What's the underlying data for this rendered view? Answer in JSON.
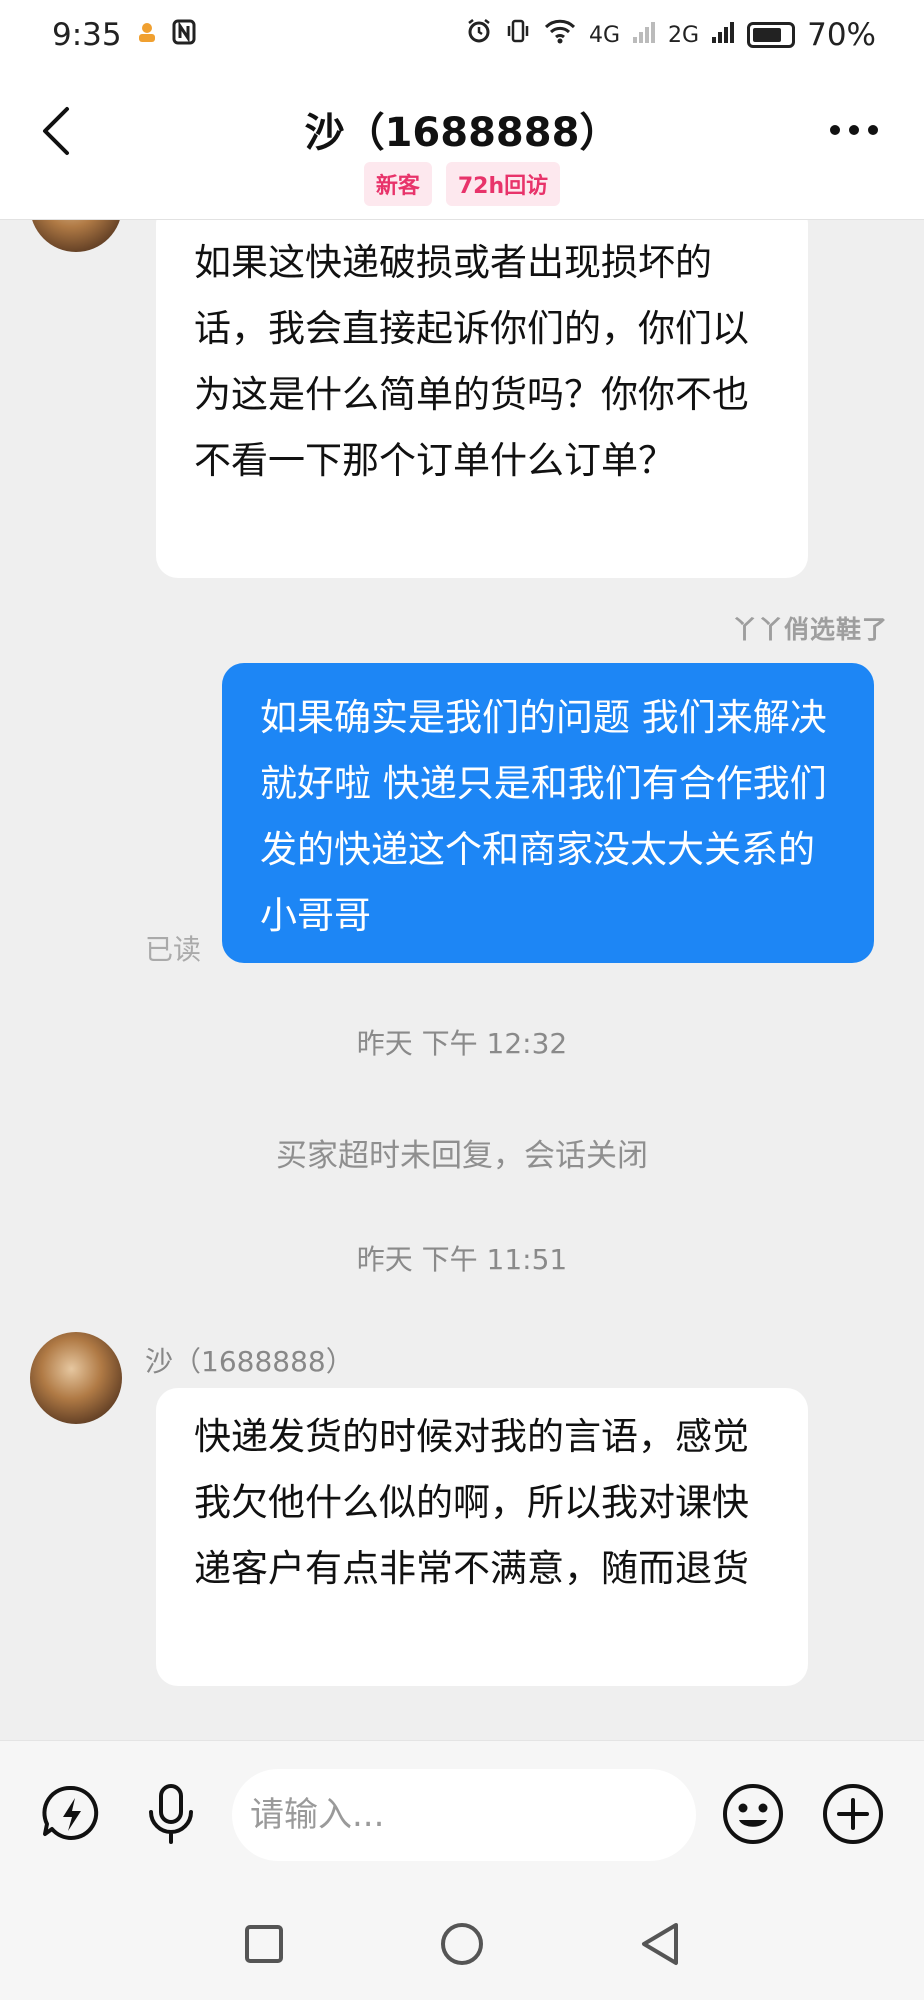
{
  "status_bar": {
    "time": "9:35",
    "signal_4g": "4G",
    "signal_2g": "2G",
    "battery": "70%"
  },
  "header": {
    "title": "沙（1688888）",
    "tags": [
      "新客",
      "72h回访"
    ]
  },
  "messages": {
    "first_incoming": "如果这快递破损或者出现损坏的话，我会直接起诉你们的，你们以为这是什么简单的货吗？你你不也不看一下那个订单什么订单？",
    "watermark": "丫丫俏选鞋了",
    "outgoing": "如果确实是我们的问题 我们来解决就好啦 快递只是和我们有合作我们发的快递这个和商家没太大关系的小哥哥",
    "read_receipt": "已读",
    "timestamp_1": "昨天 下午 12:32",
    "system_notice": "买家超时未回复，会话关闭",
    "timestamp_2": "昨天 下午 11:51",
    "sender_name": "沙（1688888）",
    "second_incoming": "快递发货的时候对我的言语，感觉我欠他什么似的啊，所以我对课快递客户有点非常不满意，随而退货"
  },
  "input_bar": {
    "placeholder": "请输入..."
  },
  "colors": {
    "outgoing_bubble": "#1d86f5",
    "tag_text": "#e8336a",
    "tag_bg": "#fde8ee",
    "chat_bg": "#efefef"
  },
  "icons": {
    "back": "chevron-left-icon",
    "more": "more-dots-icon",
    "quick_reply": "lightning-bubble-icon",
    "voice": "microphone-icon",
    "emoji": "smiley-icon",
    "add": "plus-circle-icon",
    "nav_recent": "square-icon",
    "nav_home": "circle-icon",
    "nav_back": "triangle-back-icon"
  }
}
